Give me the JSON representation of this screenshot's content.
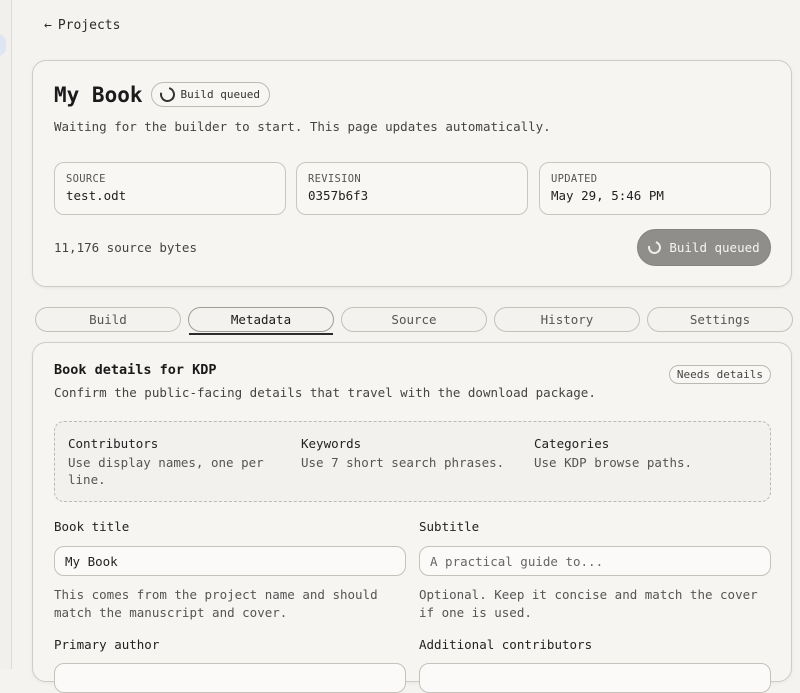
{
  "nav": {
    "back_label": "Projects"
  },
  "project": {
    "title": "My Book",
    "status_pill": "Build queued",
    "status_message": "Waiting for the builder to start. This page updates automatically.",
    "meta": [
      {
        "label": "SOURCE",
        "value": "test.odt"
      },
      {
        "label": "REVISION",
        "value": "0357b6f3"
      },
      {
        "label": "UPDATED",
        "value": "May 29, 5:46 PM"
      }
    ],
    "bytes": "11,176 source bytes",
    "action_button": "Build queued"
  },
  "tabs": [
    {
      "label": "Build"
    },
    {
      "label": "Metadata",
      "active": true
    },
    {
      "label": "Source"
    },
    {
      "label": "History"
    },
    {
      "label": "Settings"
    }
  ],
  "details": {
    "title": "Book details for KDP",
    "subtitle": "Confirm the public-facing details that travel with the download package.",
    "badge": "Needs details",
    "hints": [
      {
        "title": "Contributors",
        "body": "Use display names, one per line."
      },
      {
        "title": "Keywords",
        "body": "Use 7 short search phrases."
      },
      {
        "title": "Categories",
        "body": "Use KDP browse paths."
      }
    ],
    "fields": {
      "book_title": {
        "label": "Book title",
        "value": "My Book",
        "helper": "This comes from the project name and should match the manuscript and cover."
      },
      "subtitle": {
        "label": "Subtitle",
        "placeholder": "A practical guide to...",
        "helper": "Optional. Keep it concise and match the cover if one is used."
      },
      "primary_author": {
        "label": "Primary author"
      },
      "additional_contributors": {
        "label": "Additional contributors"
      }
    }
  },
  "colors": {
    "accent_button": "#8f8e8b",
    "background": "#f4f3f0"
  }
}
